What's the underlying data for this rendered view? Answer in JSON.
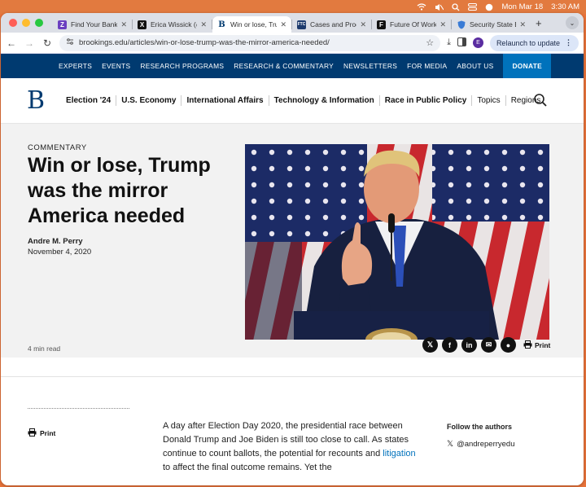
{
  "menubar": {
    "date": "Mon Mar 18",
    "time": "3:30 AM"
  },
  "tabs": [
    {
      "label": "Find Your Bank | ",
      "favicon": "Z",
      "color": "#6b3fc0",
      "active": false
    },
    {
      "label": "Erica Wissick (@",
      "favicon": "X",
      "color": "#111111",
      "active": false
    },
    {
      "label": "Win or lose, Trum",
      "favicon": "B",
      "color": "#ffffff",
      "active": true
    },
    {
      "label": "Cases and Proce",
      "favicon": "FTC",
      "color": "#1d3b6e",
      "active": false
    },
    {
      "label": "Future Of Work",
      "favicon": "F",
      "color": "#111111",
      "active": false
    },
    {
      "label": "Security State B",
      "favicon": "shield",
      "color": "#3a7bd5",
      "active": false
    }
  ],
  "toolbar": {
    "url": "brookings.edu/articles/win-or-lose-trump-was-the-mirror-america-needed/",
    "relaunch_label": "Relaunch to update",
    "avatar_letter": "E"
  },
  "topnav": {
    "items": [
      "EXPERTS",
      "EVENTS",
      "RESEARCH PROGRAMS",
      "RESEARCH & COMMENTARY",
      "NEWSLETTERS",
      "FOR MEDIA",
      "ABOUT US"
    ],
    "donate": "DONATE",
    "bg_color": "#003a70"
  },
  "mainnav": {
    "logo": "B",
    "items": [
      {
        "label": "Election '24",
        "bold": true
      },
      {
        "label": "U.S. Economy",
        "bold": true
      },
      {
        "label": "International Affairs",
        "bold": true
      },
      {
        "label": "Technology & Information",
        "bold": true
      },
      {
        "label": "Race in Public Policy",
        "bold": true
      },
      {
        "label": "Topics",
        "bold": false
      },
      {
        "label": "Regions",
        "bold": false
      }
    ]
  },
  "hero": {
    "kicker": "COMMENTARY",
    "headline": "Win or lose, Trump was the mirror America needed",
    "author": "Andre M. Perry",
    "date": "November 4, 2020"
  },
  "sharebar": {
    "read_time": "4 min read",
    "share_icons": [
      "x-icon",
      "facebook-icon",
      "linkedin-icon",
      "email-icon",
      "reddit-icon"
    ],
    "share_glyphs": [
      "𝕏",
      "f",
      "in",
      "✉",
      "●"
    ],
    "print_label": "Print"
  },
  "article": {
    "print_label": "Print",
    "body_before_link": "A day after Election Day 2020, the presidential race between Donald Trump and Joe Biden is still too close to call. As states continue to count ballots, the potential for recounts and ",
    "body_link": "litigation",
    "body_after_link": " to affect the final outcome remains. Yet the",
    "follow_label": "Follow the authors",
    "author_handle": "@andreperryedu"
  }
}
